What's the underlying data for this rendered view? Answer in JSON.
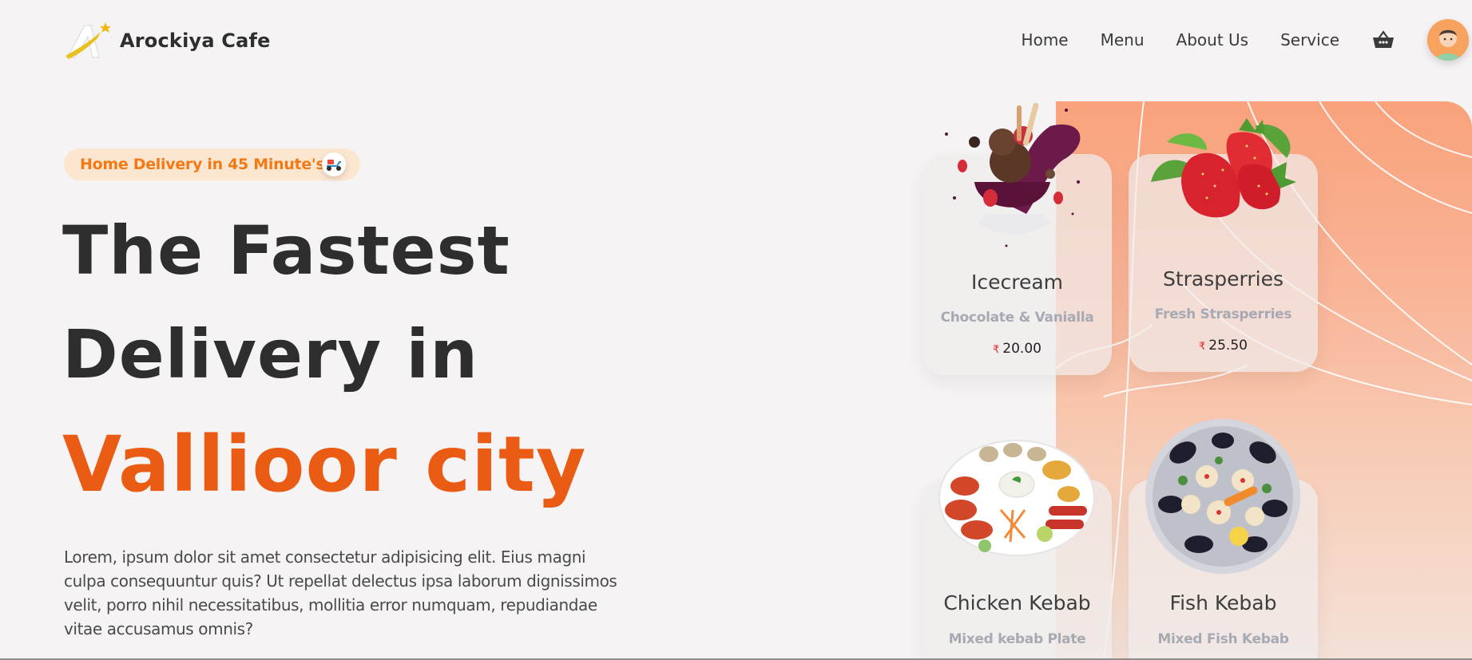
{
  "brand": {
    "name": "Arockiya Cafe"
  },
  "nav": {
    "links": [
      "Home",
      "Menu",
      "About Us",
      "Service"
    ],
    "cart_icon": "basket-icon",
    "avatar_icon": "user-avatar"
  },
  "badge": {
    "text": "Home Delivery in 45 Minute's",
    "icon": "delivery-scooter-icon"
  },
  "hero": {
    "line1": "The Fastest",
    "line2": "Delivery in",
    "line3": "Vallioor city"
  },
  "description": "Lorem, ipsum dolor sit amet consectetur adipisicing elit. Eius magni culpa consequuntur quis? Ut repellat delectus ipsa laborum dignissimos velit, porro nihil necessitatibus, mollitia error numquam, repudiandae vitae accusamus omnis?",
  "cards": [
    {
      "name": "Icecream",
      "subtitle": "Chocolate & Vanialla",
      "currency": "₹",
      "price": "20.00"
    },
    {
      "name": "Strasperries",
      "subtitle": "Fresh Strasperries",
      "currency": "₹",
      "price": "25.50"
    },
    {
      "name": "Chicken Kebab",
      "subtitle": "Mixed kebab Plate"
    },
    {
      "name": "Fish Kebab",
      "subtitle": "Mixed Fish Kebab"
    }
  ],
  "colors": {
    "accent": "#ea5c14",
    "badge_text": "#f27a16",
    "badge_bg": "#fde6cf",
    "panel": "#f9a27c"
  }
}
